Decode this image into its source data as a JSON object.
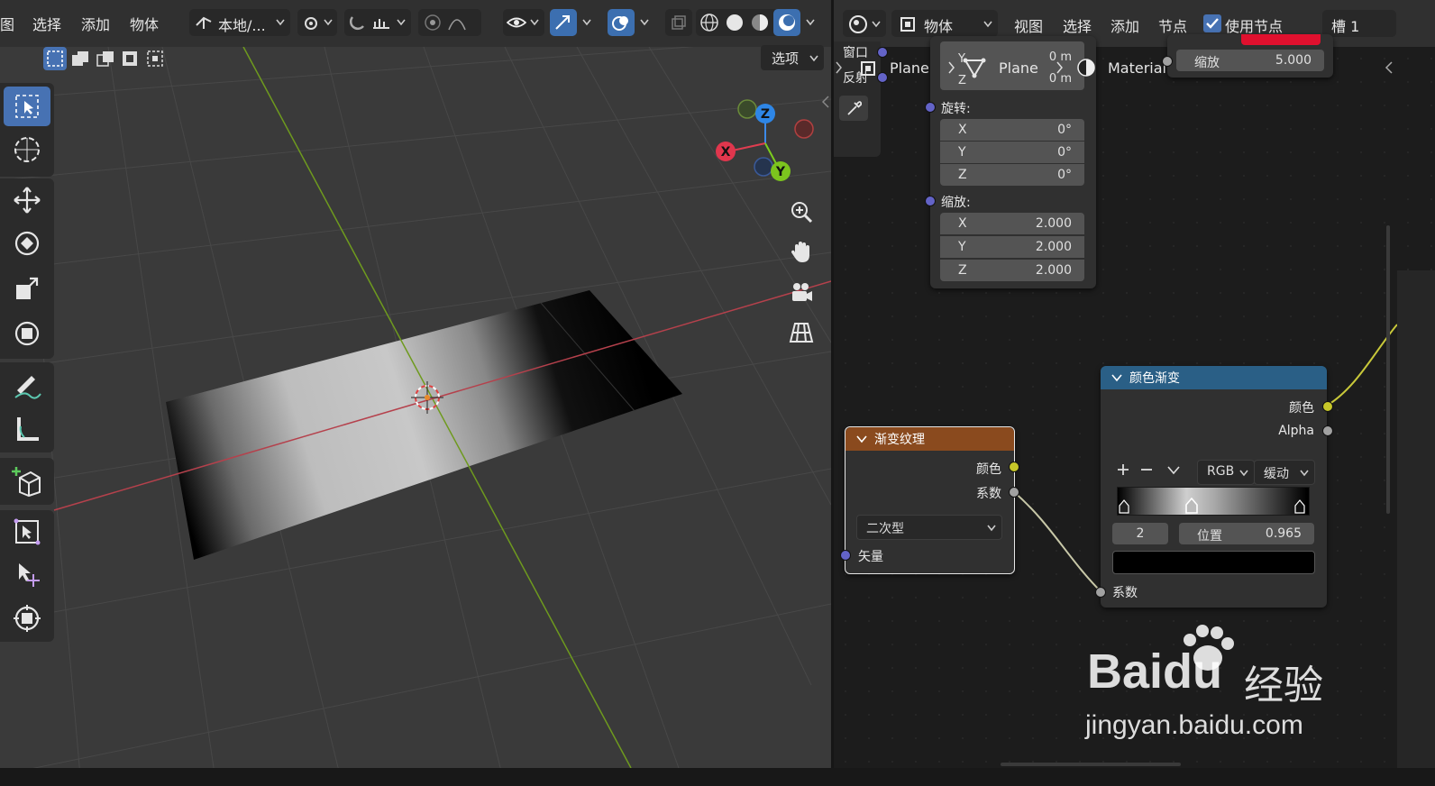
{
  "viewport": {
    "menu": [
      "图",
      "选择",
      "添加",
      "物体"
    ],
    "transform_orientation": "本地/...",
    "options_label": "选项",
    "gizmo": {
      "x": "X",
      "y": "Y",
      "z": "Z"
    },
    "toolbar_tools": [
      "select-box-icon",
      "cursor-icon",
      "move-icon",
      "rotate-icon",
      "scale-icon",
      "transform-icon",
      "annotate-icon",
      "measure-icon",
      "add-cube-icon",
      "shrink-fatten-icon",
      "select-extra-icon",
      "transform-pivot-icon"
    ]
  },
  "node_editor": {
    "header": {
      "mode": "物体",
      "menu": [
        "视图",
        "选择",
        "添加",
        "节点"
      ],
      "use_nodes_label": "使用节点",
      "slot": "槽 1"
    },
    "breadcrumb": {
      "window_label": "窗口",
      "reflect_label": "反射",
      "object": "Plane",
      "mesh": "Plane",
      "material": "Material",
      "y_label": "Y",
      "z_label": "Z",
      "y_value": "0 m",
      "z_value": "0 m"
    },
    "mapping_node": {
      "rotation_label": "旋转:",
      "rotation": [
        {
          "axis": "X",
          "value": "0°"
        },
        {
          "axis": "Y",
          "value": "0°"
        },
        {
          "axis": "Z",
          "value": "0°"
        }
      ],
      "scale_label": "缩放:",
      "scale": [
        {
          "axis": "X",
          "value": "2.000"
        },
        {
          "axis": "Y",
          "value": "2.000"
        },
        {
          "axis": "Z",
          "value": "2.000"
        }
      ]
    },
    "top_right_node": {
      "label": "缩放",
      "value": "5.000"
    },
    "gradient_node": {
      "title": "渐变纹理",
      "out_color": "颜色",
      "out_fac": "系数",
      "type": "二次型",
      "in_vector": "矢量",
      "header_color": "#8a4a1e"
    },
    "colorramp_node": {
      "title": "颜色渐变",
      "out_color": "颜色",
      "out_alpha": "Alpha",
      "color_mode": "RGB",
      "interpolation": "缓动",
      "stop_index": "2",
      "pos_label": "位置",
      "pos_value": "0.965",
      "in_fac": "系数",
      "header_color": "#2a5f86"
    }
  },
  "watermark": {
    "brand": "Baidu",
    "cn": "经验",
    "url": "jingyan.baidu.com"
  }
}
